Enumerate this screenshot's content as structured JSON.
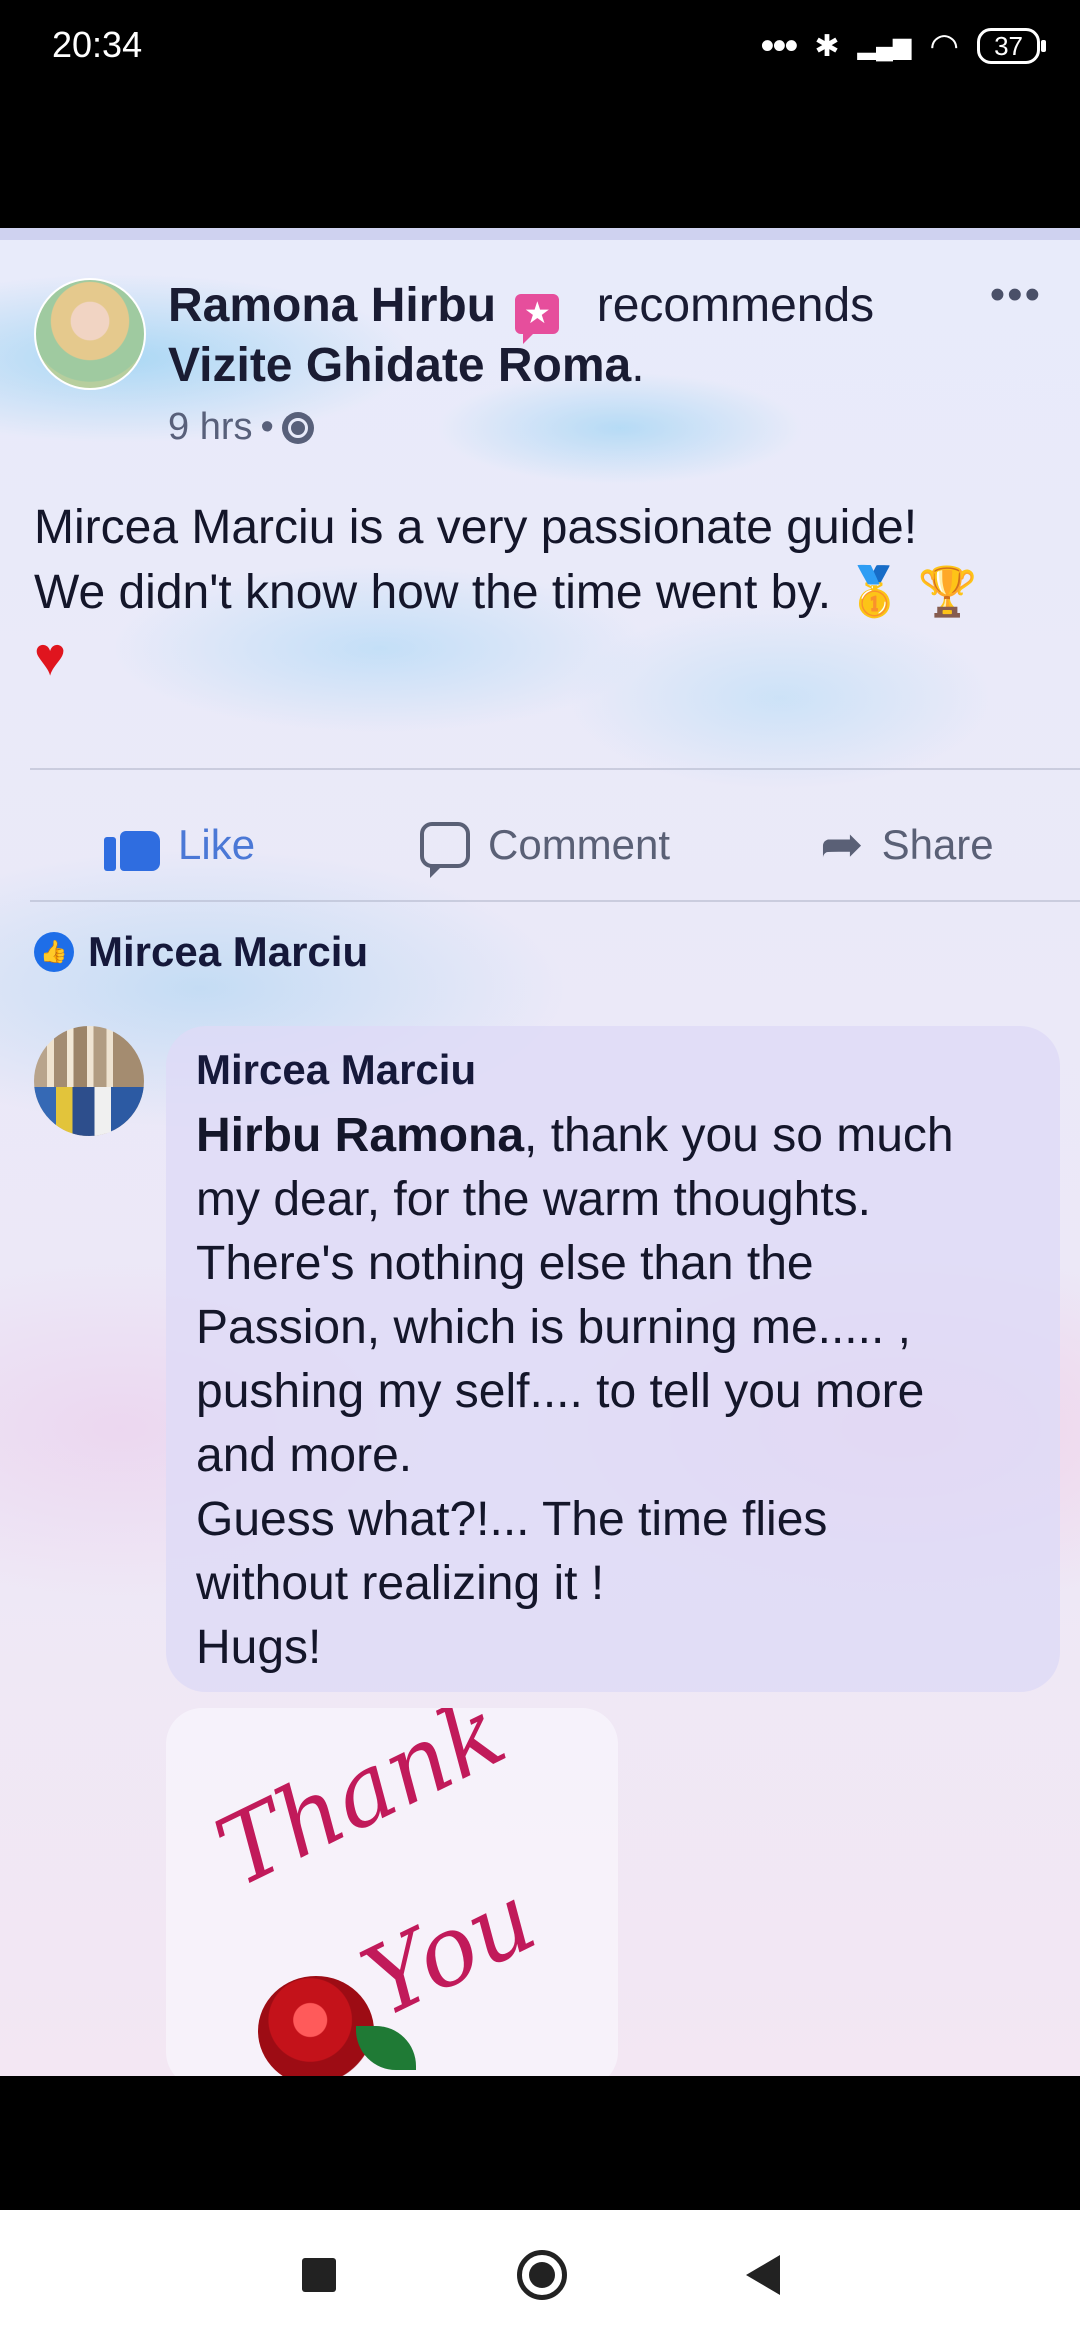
{
  "status_bar": {
    "time": "20:34",
    "signal_dots": "•••",
    "bluetooth_glyph": "✱",
    "signal_glyph": "▂▄▆",
    "wifi_glyph": "◠",
    "battery": "37"
  },
  "post": {
    "author": "Ramona Hirbu",
    "badge_glyph": "★",
    "action": "recommends",
    "page": "Vizite Ghidate Roma",
    "page_suffix": ".",
    "time": "9 hrs",
    "meta_separator": "•",
    "more_glyph": "•••",
    "text_line1": "Mircea Marciu is a very passionate guide!",
    "text_line2": "We didn't know how the time went by.",
    "emoji_medal": "🥇",
    "emoji_trophy": "🏆",
    "emoji_heart": "♥"
  },
  "actions": {
    "like": "Like",
    "comment": "Comment",
    "share": "Share",
    "share_glyph": "➦"
  },
  "liker": {
    "name": "Mircea Marciu",
    "badge_glyph": "👍"
  },
  "comment": {
    "author": "Mircea Marciu",
    "mention": "Hirbu Ramona",
    "line1_rest": ", thank you so much",
    "line2": "my dear, for the warm thoughts.",
    "line3": "There's nothing else than the",
    "line4": "Passion, which is burning me..... ,",
    "line5": "pushing my self.... to tell you more",
    "line6": "and more.",
    "line7": "Guess what?!... The time flies",
    "line8": "without realizing it !",
    "line9": "Hugs!"
  },
  "sticker": {
    "word1": "Thank",
    "word2": "You"
  },
  "colors": {
    "accent": "#1e6ee8",
    "like_blue": "#4b78d6",
    "badge_pink": "#e64e9c",
    "sticker_red": "#c11a5a"
  }
}
